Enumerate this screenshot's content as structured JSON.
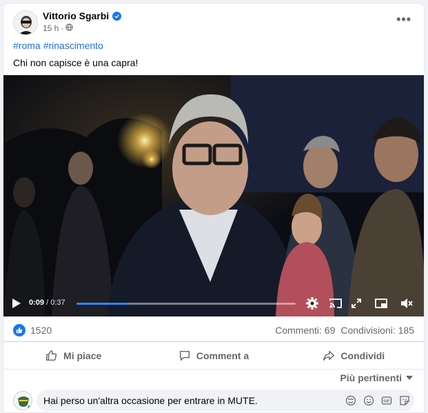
{
  "post": {
    "author": "Vittorio Sgarbi",
    "time": "15 h",
    "hashtags": [
      "#roma",
      "#rinascimento"
    ],
    "text": "Chi non capisce è una capra!"
  },
  "video": {
    "current_time": "0:09",
    "duration": "/ 0:37",
    "progress": 0.24
  },
  "stats": {
    "likes": "1520",
    "comments": "Commenti: 69",
    "shares": "Condivisioni: 185"
  },
  "actions": {
    "like": "Mi piace",
    "comment": "Comment a",
    "share": "Condividi"
  },
  "sort_label": "Più pertinenti",
  "comment_box": {
    "value": "Hai perso un'altra occasione per entrare in MUTE."
  },
  "colors": {
    "accent": "#1877f2",
    "link": "#216fdb",
    "progress": "#2d88ff"
  }
}
